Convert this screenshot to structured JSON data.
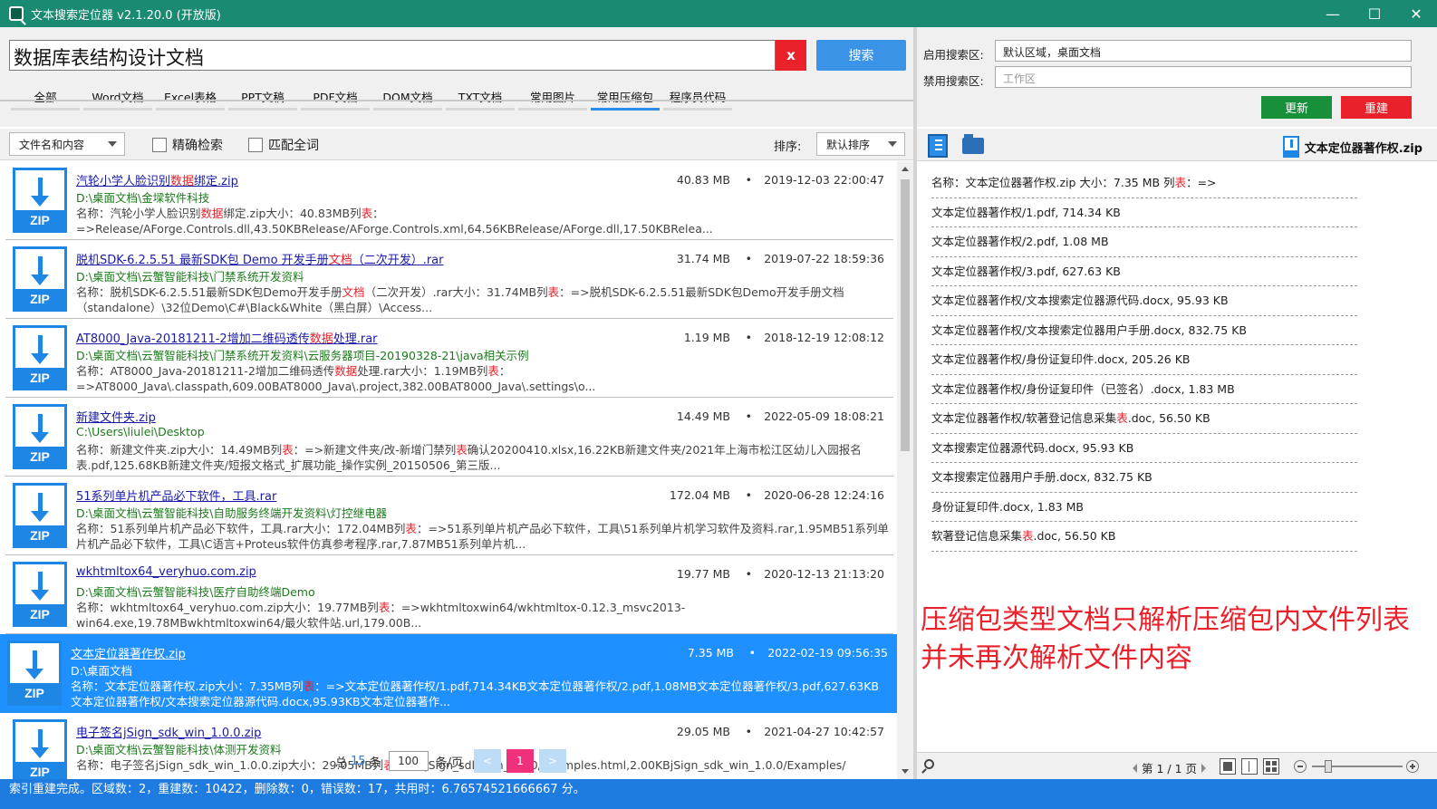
{
  "window": {
    "title": "文本搜索定位器 v2.1.20.0 (开放版)",
    "minimize": "—",
    "maximize": "☐",
    "close": "✕"
  },
  "search": {
    "query": "数据库表结构设计文档",
    "clear_label": "x",
    "button_label": "搜索"
  },
  "tabs": [
    {
      "label": "全部",
      "active": false
    },
    {
      "label": "Word文档",
      "active": false
    },
    {
      "label": "Excel表格",
      "active": false
    },
    {
      "label": "PPT文稿",
      "active": false
    },
    {
      "label": "PDF文档",
      "active": false
    },
    {
      "label": "DOM文档",
      "active": false
    },
    {
      "label": "TXT文档",
      "active": false
    },
    {
      "label": "常用图片",
      "active": false
    },
    {
      "label": "常用压缩包",
      "active": true
    },
    {
      "label": "程序员代码",
      "active": false
    }
  ],
  "filters": {
    "scope_select": "文件名和内容",
    "exact_label": "精确检索",
    "whole_word_label": "匹配全词",
    "sort_label": "排序:",
    "sort_select": "默认排序"
  },
  "results": [
    {
      "name": [
        "汽轮小学人脸识别",
        "数据",
        "绑定.zip"
      ],
      "path": "D:\\桌面文档\\金墚软件科技",
      "summary": [
        "名称：汽轮小学人脸识别",
        "数据",
        "绑定.zip大小：40.83MB列",
        "表",
        "：=>Release/AForge.Controls.dll,43.50KBRelease/AForge.Controls.xml,64.56KBRelease/AForge.dll,17.50KBRelea..."
      ],
      "size": "40.83 MB",
      "date": "2019-12-03 22:00:47",
      "selected": false
    },
    {
      "name": [
        "脱机SDK-6.2.5.51 最新SDK包 Demo 开发手册",
        "文档",
        "（二次开发）.rar"
      ],
      "path": "D:\\桌面文档\\云蟹智能科技\\门禁系统开发资料",
      "summary": [
        "名称：脱机SDK-6.2.5.51最新SDK包Demo开发手册",
        "文档",
        "（二次开发）.rar大小：31.74MB列",
        "表",
        "：=>脱机SDK-6.2.5.51最新SDK包Demo开发手册文档（standalone）\\32位Demo\\C#\\Black&White（黑白屏）\\Access..."
      ],
      "size": "31.74 MB",
      "date": "2019-07-22 18:59:36",
      "selected": false
    },
    {
      "name": [
        "AT8000_Java-20181211-2增加二维码透传",
        "数据",
        "处理.rar"
      ],
      "path": "D:\\桌面文档\\云蟹智能科技\\门禁系统开发资料\\云服务器项目-20190328-21\\java相关示例",
      "summary": [
        "名称：AT8000_Java-20181211-2增加二维码透传",
        "数据",
        "处理.rar大小：1.19MB列",
        "表",
        "：=>AT8000_Java\\.classpath,609.00BAT8000_Java\\.project,382.00BAT8000_Java\\.settings\\o..."
      ],
      "size": "1.19 MB",
      "date": "2018-12-19 12:08:12",
      "selected": false
    },
    {
      "name": [
        "新建文件夹.zip",
        "",
        ""
      ],
      "path": "C:\\Users\\liulei\\Desktop",
      "summary": [
        "名称：新建文件夹.zip大小：14.49MB列",
        "表",
        "：=>新建文件夹/改-新增门禁列",
        "表",
        "确认20200410.xlsx,16.22KB新建文件夹/2021年上海市松江区幼儿入园报名表.pdf,125.68KB新建文件夹/短报文格式_扩展功能_操作实例_20150506_第三版..."
      ],
      "size": "14.49 MB",
      "date": "2022-05-09 18:08:21",
      "selected": false
    },
    {
      "name": [
        "51系列单片机产品必下软件，工具.rar",
        "",
        ""
      ],
      "path": "D:\\桌面文档\\云蟹智能科技\\自助服务终端开发资料\\灯控继电器",
      "summary": [
        "名称：51系列单片机产品必下软件，工具.rar大小：172.04MB列",
        "表",
        "：=>51系列单片机产品必下软件，工具\\51系列单片机学习软件及资料.rar,1.95MB51系列单片机产品必下软件，工具\\C语言+Proteus软件仿真参考程序.rar,7.87MB51系列单片机...",
        "",
        ""
      ],
      "size": "172.04 MB",
      "date": "2020-06-28 12:24:16",
      "selected": false
    },
    {
      "name": [
        "wkhtmltox64_veryhuo.com.zip",
        "",
        ""
      ],
      "path": "D:\\桌面文档\\云蟹智能科技\\医疗自助终端Demo",
      "summary": [
        "名称：wkhtmltox64_veryhuo.com.zip大小：19.77MB列",
        "表",
        "：=>wkhtmltoxwin64/wkhtmltox-0.12.3_msvc2013-win64.exe,19.78MBwkhtmltoxwin64/最火软件站.url,179.00B...",
        "",
        ""
      ],
      "size": "19.77 MB",
      "date": "2020-12-13 21:13:20",
      "selected": false
    },
    {
      "name": [
        "文本定位器著作权.zip",
        "",
        ""
      ],
      "path": "D:\\桌面文档",
      "summary": [
        "名称：文本定位器著作权.zip大小：7.35MB列",
        "表",
        "：=>文本定位器著作权/1.pdf,714.34KB文本定位器著作权/2.pdf,1.08MB文本定位器著作权/3.pdf,627.63KB文本定位器著作权/文本搜索定位器源代码.docx,95.93KB文本定位器著作...",
        "",
        ""
      ],
      "size": "7.35 MB",
      "date": "2022-02-19 09:56:35",
      "selected": true
    },
    {
      "name": [
        "电子签名jSign_sdk_win_1.0.0.zip",
        "",
        ""
      ],
      "path": "D:\\桌面文档\\云蟹智能科技\\体测开发资料",
      "summary": [
        "名称：电子签名jSign_sdk_win_1.0.0.zip大小：29.05MB列",
        "表",
        "：=>jSign_sdk_win_1.0.0/Examples.html,2.00KBjSign_sdk_win_1.0.0/Examples/",
        "",
        ""
      ],
      "size": "29.05 MB",
      "date": "2021-04-27 10:42:57",
      "selected": false
    }
  ],
  "pager": {
    "total_prefix": "总",
    "total": "15",
    "total_suffix": "条",
    "page_size": "100",
    "page_size_suffix": "条/页",
    "prev": "<",
    "current": "1",
    "next": ">"
  },
  "scope": {
    "enabled_label": "启用搜索区:",
    "enabled_value": "默认区域，桌面文档",
    "disabled_label": "禁用搜索区:",
    "disabled_placeholder": "工作区",
    "update_label": "更新",
    "rebuild_label": "重建"
  },
  "preview": {
    "file_title": "文本定位器著作权.zip",
    "header": [
      "名称：文本定位器著作权.zip   大小：7.35 MB   列",
      "表",
      "：=>"
    ],
    "rows": [
      [
        "文本定位器著作权/1.pdf,   714.34 KB",
        "",
        ""
      ],
      [
        "文本定位器著作权/2.pdf,   1.08 MB",
        "",
        ""
      ],
      [
        "文本定位器著作权/3.pdf,   627.63 KB",
        "",
        ""
      ],
      [
        "文本定位器著作权/文本搜索定位器源代码.docx,   95.93 KB",
        "",
        ""
      ],
      [
        "文本定位器著作权/文本搜索定位器用户手册.docx,   832.75 KB",
        "",
        ""
      ],
      [
        "文本定位器著作权/身份证复印件.docx,   205.26 KB",
        "",
        ""
      ],
      [
        "文本定位器著作权/身份证复印件（已签名）.docx,   1.83 MB",
        "",
        ""
      ],
      [
        "文本定位器著作权/软著登记信息采集",
        "表",
        ".doc,   56.50 KB"
      ],
      [
        "文本搜索定位器源代码.docx,   95.93 KB",
        "",
        ""
      ],
      [
        "文本搜索定位器用户手册.docx,   832.75 KB",
        "",
        ""
      ],
      [
        "身份证复印件.docx,   1.83 MB",
        "",
        ""
      ],
      [
        "软著登记信息采集",
        "表",
        ".doc,   56.50 KB"
      ]
    ],
    "annotation_line1": "压缩包类型文档只解析压缩包内文件列表",
    "annotation_line2": "并未再次解析文件内容",
    "page_info": "第 1 / 1 页"
  },
  "status": "索引重建完成。区域数：2，重建数：10422，删除数：0，错误数：17，共用时：6.76574521666667 分。",
  "colors": {
    "titlebar": "#1a8a73",
    "accent": "#2b8de8",
    "highlight": "#e8212b",
    "selected_row": "#1e90ff",
    "statusbar": "#1e7be0"
  },
  "icons": [
    "app-icon",
    "zip-file-icon",
    "search-icon",
    "locate-icon",
    "open-folder-icon"
  ]
}
